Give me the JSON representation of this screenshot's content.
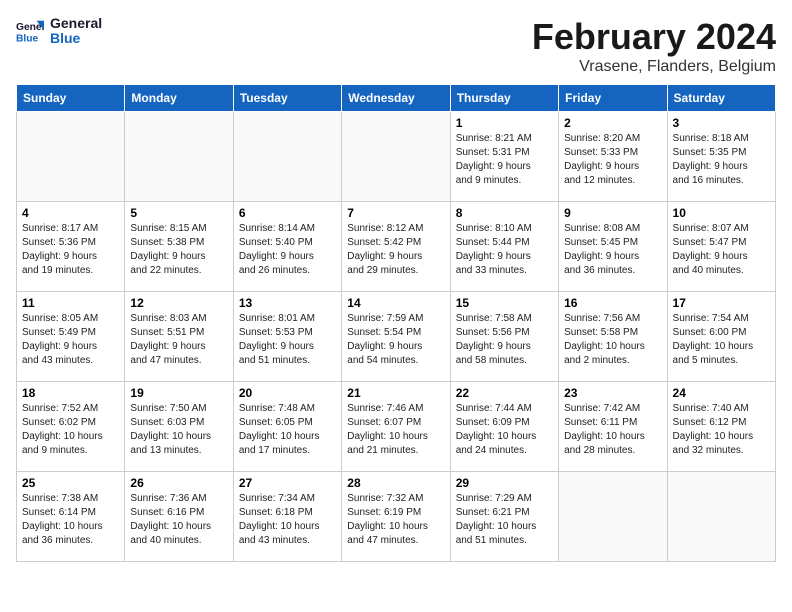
{
  "logo": {
    "general": "General",
    "blue": "Blue"
  },
  "header": {
    "month": "February 2024",
    "location": "Vrasene, Flanders, Belgium"
  },
  "weekdays": [
    "Sunday",
    "Monday",
    "Tuesday",
    "Wednesday",
    "Thursday",
    "Friday",
    "Saturday"
  ],
  "weeks": [
    [
      {
        "day": "",
        "info": ""
      },
      {
        "day": "",
        "info": ""
      },
      {
        "day": "",
        "info": ""
      },
      {
        "day": "",
        "info": ""
      },
      {
        "day": "1",
        "info": "Sunrise: 8:21 AM\nSunset: 5:31 PM\nDaylight: 9 hours\nand 9 minutes."
      },
      {
        "day": "2",
        "info": "Sunrise: 8:20 AM\nSunset: 5:33 PM\nDaylight: 9 hours\nand 12 minutes."
      },
      {
        "day": "3",
        "info": "Sunrise: 8:18 AM\nSunset: 5:35 PM\nDaylight: 9 hours\nand 16 minutes."
      }
    ],
    [
      {
        "day": "4",
        "info": "Sunrise: 8:17 AM\nSunset: 5:36 PM\nDaylight: 9 hours\nand 19 minutes."
      },
      {
        "day": "5",
        "info": "Sunrise: 8:15 AM\nSunset: 5:38 PM\nDaylight: 9 hours\nand 22 minutes."
      },
      {
        "day": "6",
        "info": "Sunrise: 8:14 AM\nSunset: 5:40 PM\nDaylight: 9 hours\nand 26 minutes."
      },
      {
        "day": "7",
        "info": "Sunrise: 8:12 AM\nSunset: 5:42 PM\nDaylight: 9 hours\nand 29 minutes."
      },
      {
        "day": "8",
        "info": "Sunrise: 8:10 AM\nSunset: 5:44 PM\nDaylight: 9 hours\nand 33 minutes."
      },
      {
        "day": "9",
        "info": "Sunrise: 8:08 AM\nSunset: 5:45 PM\nDaylight: 9 hours\nand 36 minutes."
      },
      {
        "day": "10",
        "info": "Sunrise: 8:07 AM\nSunset: 5:47 PM\nDaylight: 9 hours\nand 40 minutes."
      }
    ],
    [
      {
        "day": "11",
        "info": "Sunrise: 8:05 AM\nSunset: 5:49 PM\nDaylight: 9 hours\nand 43 minutes."
      },
      {
        "day": "12",
        "info": "Sunrise: 8:03 AM\nSunset: 5:51 PM\nDaylight: 9 hours\nand 47 minutes."
      },
      {
        "day": "13",
        "info": "Sunrise: 8:01 AM\nSunset: 5:53 PM\nDaylight: 9 hours\nand 51 minutes."
      },
      {
        "day": "14",
        "info": "Sunrise: 7:59 AM\nSunset: 5:54 PM\nDaylight: 9 hours\nand 54 minutes."
      },
      {
        "day": "15",
        "info": "Sunrise: 7:58 AM\nSunset: 5:56 PM\nDaylight: 9 hours\nand 58 minutes."
      },
      {
        "day": "16",
        "info": "Sunrise: 7:56 AM\nSunset: 5:58 PM\nDaylight: 10 hours\nand 2 minutes."
      },
      {
        "day": "17",
        "info": "Sunrise: 7:54 AM\nSunset: 6:00 PM\nDaylight: 10 hours\nand 5 minutes."
      }
    ],
    [
      {
        "day": "18",
        "info": "Sunrise: 7:52 AM\nSunset: 6:02 PM\nDaylight: 10 hours\nand 9 minutes."
      },
      {
        "day": "19",
        "info": "Sunrise: 7:50 AM\nSunset: 6:03 PM\nDaylight: 10 hours\nand 13 minutes."
      },
      {
        "day": "20",
        "info": "Sunrise: 7:48 AM\nSunset: 6:05 PM\nDaylight: 10 hours\nand 17 minutes."
      },
      {
        "day": "21",
        "info": "Sunrise: 7:46 AM\nSunset: 6:07 PM\nDaylight: 10 hours\nand 21 minutes."
      },
      {
        "day": "22",
        "info": "Sunrise: 7:44 AM\nSunset: 6:09 PM\nDaylight: 10 hours\nand 24 minutes."
      },
      {
        "day": "23",
        "info": "Sunrise: 7:42 AM\nSunset: 6:11 PM\nDaylight: 10 hours\nand 28 minutes."
      },
      {
        "day": "24",
        "info": "Sunrise: 7:40 AM\nSunset: 6:12 PM\nDaylight: 10 hours\nand 32 minutes."
      }
    ],
    [
      {
        "day": "25",
        "info": "Sunrise: 7:38 AM\nSunset: 6:14 PM\nDaylight: 10 hours\nand 36 minutes."
      },
      {
        "day": "26",
        "info": "Sunrise: 7:36 AM\nSunset: 6:16 PM\nDaylight: 10 hours\nand 40 minutes."
      },
      {
        "day": "27",
        "info": "Sunrise: 7:34 AM\nSunset: 6:18 PM\nDaylight: 10 hours\nand 43 minutes."
      },
      {
        "day": "28",
        "info": "Sunrise: 7:32 AM\nSunset: 6:19 PM\nDaylight: 10 hours\nand 47 minutes."
      },
      {
        "day": "29",
        "info": "Sunrise: 7:29 AM\nSunset: 6:21 PM\nDaylight: 10 hours\nand 51 minutes."
      },
      {
        "day": "",
        "info": ""
      },
      {
        "day": "",
        "info": ""
      }
    ]
  ]
}
